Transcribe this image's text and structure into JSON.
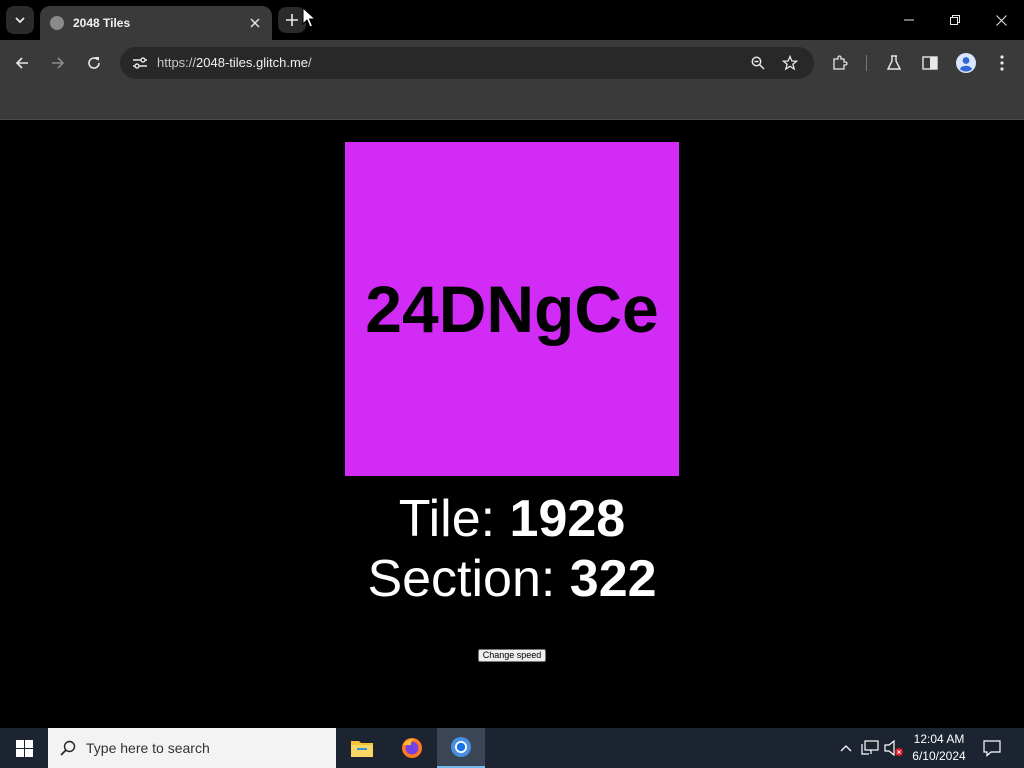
{
  "browser": {
    "tab": {
      "title": "2048 Tiles"
    },
    "address_bar": {
      "scheme": "https://",
      "host": "2048-tiles.glitch.me",
      "path": "/"
    },
    "icons": [
      "tab-search-icon",
      "close-icon",
      "plus-icon",
      "minimize-icon",
      "restore-icon",
      "window-close-icon",
      "back-icon",
      "forward-icon",
      "reload-icon",
      "site-info-icon",
      "zoom-icon",
      "star-icon",
      "extensions-icon",
      "labs-icon",
      "side-panel-icon",
      "profile-icon",
      "more-icon"
    ]
  },
  "page": {
    "tile": {
      "text": "24DNgCe",
      "color": "#d22bf5"
    },
    "tile_line": {
      "label": "Tile: ",
      "value": "1928"
    },
    "section_line": {
      "label": "Section: ",
      "value": "322"
    },
    "speed_button": "Change speed"
  },
  "taskbar": {
    "search_placeholder": "Type here to search",
    "apps": [
      "file-explorer-icon",
      "firefox-icon",
      "chrome-icon"
    ],
    "clock": {
      "time": "12:04 AM",
      "date": "6/10/2024"
    }
  }
}
